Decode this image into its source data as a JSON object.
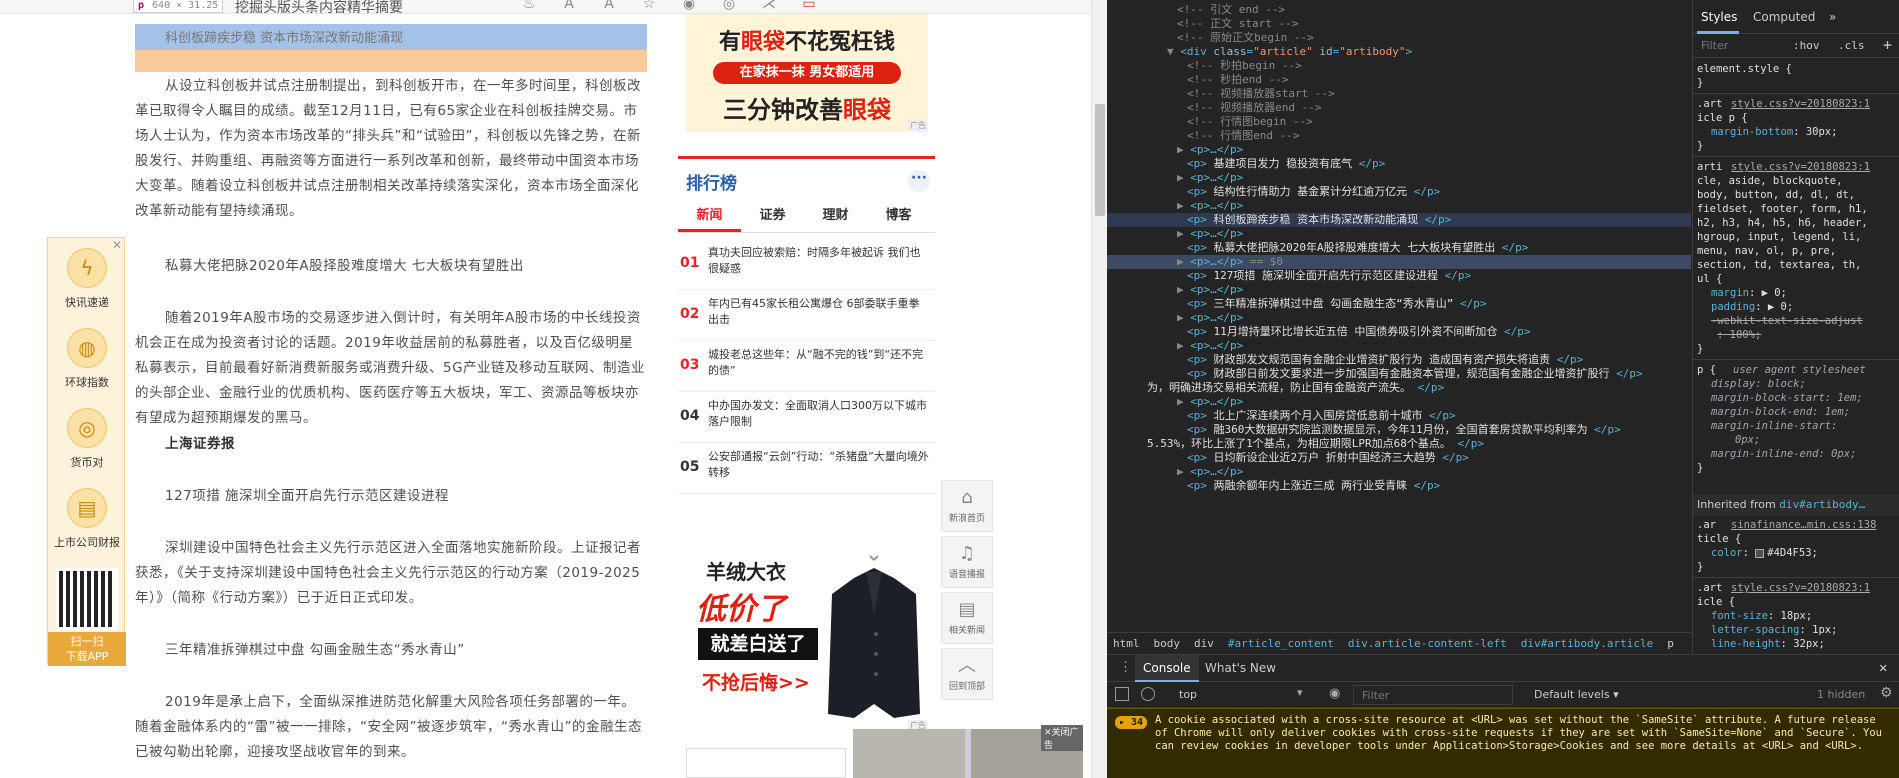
{
  "browser": {
    "tooltip_tag": "p",
    "tooltip_size": "640 × 31.25",
    "crumb": "挖掘头版头条内容精华摘要"
  },
  "highlight": {
    "text": "科创板蹄疾步稳 资本市场深改新动能涌现"
  },
  "article": {
    "p1": "从设立科创板并试点注册制提出，到科创板开市，在一年多时间里，科创板改革已取得令人瞩目的成绩。截至12月11日，已有65家企业在科创板挂牌交易。市场人士认为，作为资本市场改革的“排头兵”和“试验田”，科创板以先锋之势，在新股发行、并购重组、再融资等方面进行一系列改革和创新，最终带动中国资本市场大变革。随着设立科创板并试点注册制相关改革持续落实深化，资本市场全面深化改革新动能有望持续涌现。",
    "p2": "私募大佬把脉2020年A股择股难度增大 七大板块有望胜出",
    "p3": "随着2019年A股市场的交易逐步进入倒计时，有关明年A股市场的中长线投资机会正在成为投资者讨论的话题。2019年收益居前的私募胜者，以及百亿级明星私募表示，目前最看好新消费新服务或消费升级、5G产业链及移动互联网、制造业的头部企业、金融行业的优质机构、医药医疗等五大板块，军工、资源品等板块亦有望成为超预期爆发的黑马。",
    "p4": "上海证券报",
    "p5": "127项措 施深圳全面开启先行示范区建设进程",
    "p6": "深圳建设中国特色社会主义先行示范区进入全面落地实施新阶段。上证报记者获悉，《关于支持深圳建设中国特色社会主义先行示范区的行动方案（2019-2025年）》（简称《行动方案》）已于近日正式印发。",
    "p7": "三年精准拆弹棋过中盘 勾画金融生态“秀水青山”",
    "p8": "2019年是承上启下，全面纵深推进防范化解重大风险各项任务部署的一年。随着金融体系内的“雷”被一一排除，“安全网”被逐步筑牢，“秀水青山”的金融生态已被勾勒出轮廓，迎接攻坚战收官年的到来。"
  },
  "ad_top": {
    "line1a": "有",
    "line1b": "眼袋",
    "line1c": "不花冤枉钱",
    "pill": "在家抹一抹 男女都适用",
    "line3a": "三分钟改善",
    "line3b": "眼袋",
    "tag": "广告"
  },
  "ranking": {
    "title": "排行榜",
    "more": "···",
    "tabs": [
      "新闻",
      "证券",
      "理财",
      "博客"
    ],
    "items": [
      {
        "n": "01",
        "t": "真功夫回应被索赔：时隔多年被起诉 我们也很疑惑"
      },
      {
        "n": "02",
        "t": "年内已有45家长租公寓爆仓 6部委联手重拳出击"
      },
      {
        "n": "03",
        "t": "城投老总这些年：从“融不完的钱”到“还不完的债”"
      },
      {
        "n": "04",
        "t": "中办国办发文：全面取消人口300万以下城市落户限制"
      },
      {
        "n": "05",
        "t": "公安部通报“云剑”行动：“杀猪盘”大量向境外转移"
      }
    ]
  },
  "ad_bottom": {
    "a": "羊绒大衣",
    "b": "低价了",
    "c": "就差白送了",
    "d": "不抢后悔>>",
    "tag": "广告"
  },
  "float_nav": [
    {
      "icon": "⌂",
      "label": "新浪首页"
    },
    {
      "icon": "♫",
      "label": "语音播报"
    },
    {
      "icon": "▤",
      "label": "相关新闻"
    },
    {
      "icon": "︿",
      "label": "回到顶部"
    }
  ],
  "left_bar": {
    "close": "✕",
    "items": [
      {
        "icon": "ϟ",
        "label": "快讯速递"
      },
      {
        "icon": "◍",
        "label": "环球指数"
      },
      {
        "icon": "◎",
        "label": "货币对"
      },
      {
        "icon": "▤",
        "label": "上市公司财报"
      }
    ],
    "qr_label": "扫一扫\n下载APP"
  },
  "photos_tag": "✕关闭广告",
  "devtools": {
    "elements": [
      {
        "indent": 5,
        "type": "comment",
        "text": "<!-- 引文 end -->"
      },
      {
        "indent": 5,
        "type": "comment",
        "text": "<!-- 正文 start -->"
      },
      {
        "indent": 5,
        "type": "comment",
        "text": "<!-- 原始正文begin -->"
      },
      {
        "indent": 4,
        "type": "open",
        "arrow": "▼",
        "tag": "div",
        "attrs": [
          [
            "class",
            "article"
          ],
          [
            "id",
            "artibody"
          ]
        ]
      },
      {
        "indent": 6,
        "type": "comment",
        "text": "<!-- 秒拍begin -->"
      },
      {
        "indent": 6,
        "type": "comment",
        "text": "<!-- 秒拍end -->"
      },
      {
        "indent": 6,
        "type": "comment",
        "text": "<!-- 视频播放器start -->"
      },
      {
        "indent": 6,
        "type": "comment",
        "text": "<!-- 视频播放器end -->"
      },
      {
        "indent": 6,
        "type": "comment",
        "text": "<!-- 行情图begin -->"
      },
      {
        "indent": 6,
        "type": "comment",
        "text": "<!-- 行情图end -->"
      },
      {
        "indent": 5,
        "type": "collapsed",
        "arrow": "▶",
        "text": "<p>…</p>"
      },
      {
        "indent": 6,
        "type": "ptext",
        "text": "基建项目发力 稳投资有底气"
      },
      {
        "indent": 5,
        "type": "collapsed",
        "arrow": "▶",
        "text": "<p>…</p>"
      },
      {
        "indent": 6,
        "type": "ptext",
        "text": "结构性行情助力 基金累计分红逾万亿元"
      },
      {
        "indent": 5,
        "type": "collapsed",
        "arrow": "▶",
        "text": "<p>…</p>"
      },
      {
        "indent": 6,
        "type": "ptext",
        "text": "科创板蹄疾步稳 资本市场深改新动能涌现",
        "hover": true
      },
      {
        "indent": 5,
        "type": "collapsed",
        "arrow": "▶",
        "text": "<p>…</p>"
      },
      {
        "indent": 6,
        "type": "ptext",
        "text": "私募大佬把脉2020年A股择股难度增大 七大板块有望胜出"
      },
      {
        "indent": 5,
        "type": "collapsed",
        "arrow": "▶",
        "text": "<p>…</p>",
        "suffix": " == $0",
        "selected": true
      },
      {
        "indent": 6,
        "type": "ptext",
        "text": "127项措 施深圳全面开启先行示范区建设进程"
      },
      {
        "indent": 5,
        "type": "collapsed",
        "arrow": "▶",
        "text": "<p>…</p>"
      },
      {
        "indent": 6,
        "type": "ptext",
        "text": "三年精准拆弹棋过中盘 勾画金融生态“秀水青山”"
      },
      {
        "indent": 5,
        "type": "collapsed",
        "arrow": "▶",
        "text": "<p>…</p>"
      },
      {
        "indent": 6,
        "type": "ptext",
        "text": "11月增持量环比增长近五倍 中国债券吸引外资不间断加仓"
      },
      {
        "indent": 5,
        "type": "collapsed",
        "arrow": "▶",
        "text": "<p>…</p>"
      },
      {
        "indent": 6,
        "type": "ptext",
        "text": "财政部发文规范国有金融企业增资扩股行为 造成国有资产损失将追责"
      },
      {
        "indent": 6,
        "type": "ptext",
        "text": "财政部日前发文要求进一步加强国有金融资本管理，规范国有金融企业增资扩股行"
      },
      {
        "indent": 6,
        "type": "ptextcont",
        "text": "为，明确进场交易相关流程，防止国有金融资产流失。"
      },
      {
        "indent": 5,
        "type": "collapsed",
        "arrow": "▶",
        "text": "<p>…</p>"
      },
      {
        "indent": 6,
        "type": "ptext",
        "text": "北上广深连续两个月入围房贷低息前十城市"
      },
      {
        "indent": 6,
        "type": "ptext",
        "text": "融360大数据研究院监测数据显示，今年11月份，全国首套房贷款平均利率为"
      },
      {
        "indent": 6,
        "type": "ptextcont",
        "text": "5.53%，环比上涨了1个基点，为相应期限LPR加点68个基点。"
      },
      {
        "indent": 6,
        "type": "ptext",
        "text": "日均新设企业近2万户 折射中国经济三大趋势"
      },
      {
        "indent": 5,
        "type": "collapsed",
        "arrow": "▶",
        "text": "<p>…</p>"
      },
      {
        "indent": 6,
        "type": "ptext",
        "text": "两融余额年内上涨近三成 两行业受青睐"
      }
    ],
    "breadcrumbs": [
      "html",
      "body",
      "div",
      "#article_content",
      "div.article-content-left",
      "div#artibody.article",
      "p"
    ],
    "styles": {
      "tabs": [
        "Styles",
        "Computed",
        "»"
      ],
      "filter_placeholder": "Filter",
      "hov": ":hov",
      "cls": ".cls",
      "plus": "+",
      "rules": [
        {
          "type": "sel",
          "text": "element.style {"
        },
        {
          "type": "close",
          "text": "}"
        },
        {
          "type": "gap"
        },
        {
          "type": "selsrc",
          "text": ".art",
          "src": "style.css?v=20180823:1"
        },
        {
          "type": "sel",
          "text": "icle p {"
        },
        {
          "type": "prop",
          "name": "margin-bottom",
          "value": "30px;"
        },
        {
          "type": "close",
          "text": "}"
        },
        {
          "type": "gap"
        },
        {
          "type": "selsrc",
          "text": "arti",
          "src": "style.css?v=20180823:1"
        },
        {
          "type": "sel",
          "text": "cle, aside, blockquote,"
        },
        {
          "type": "sel",
          "text": "body, button, dd, dl, dt,"
        },
        {
          "type": "sel",
          "text": "fieldset, footer, form, h1,"
        },
        {
          "type": "sel",
          "text": "h2, h3, h4, h5, h6, header,"
        },
        {
          "type": "sel",
          "text": "hgroup, input, legend, li,"
        },
        {
          "type": "sel",
          "text": "menu, nav, ol, p, pre,"
        },
        {
          "type": "sel",
          "text": "section, td, textarea, th,"
        },
        {
          "type": "sel",
          "text": "ul {"
        },
        {
          "type": "prop",
          "name": "margin",
          "value": "▶ 0;"
        },
        {
          "type": "prop",
          "name": "padding",
          "value": "▶ 0;"
        },
        {
          "type": "strike",
          "text": "-webkit-text-size-adjust"
        },
        {
          "type": "strike2",
          "text": ": 100%;"
        },
        {
          "type": "close",
          "text": "}"
        },
        {
          "type": "gap"
        },
        {
          "type": "uasrc",
          "text": "p {",
          "src": "user agent stylesheet"
        },
        {
          "type": "ua",
          "text": "display: block;"
        },
        {
          "type": "ua",
          "text": "margin-block-start: 1em;"
        },
        {
          "type": "ua",
          "text": "margin-block-end: 1em;"
        },
        {
          "type": "ua",
          "text": "margin-inline-start:"
        },
        {
          "type": "ua2",
          "text": "0px;"
        },
        {
          "type": "ua",
          "text": "margin-inline-end: 0px;"
        },
        {
          "type": "close",
          "text": "}"
        }
      ],
      "inherited_label": "Inherited from",
      "inherited_from": "div#artibody…",
      "rules2": [
        {
          "type": "selsrc",
          "text": ".ar",
          "src": "sinafinance…min.css:138"
        },
        {
          "type": "sel",
          "text": "ticle {"
        },
        {
          "type": "propc",
          "name": "color",
          "value": "#4D4F53;"
        },
        {
          "type": "close",
          "text": "}"
        },
        {
          "type": "gap"
        },
        {
          "type": "selsrc",
          "text": ".art",
          "src": "style.css?v=20180823:1"
        },
        {
          "type": "sel",
          "text": "icle {"
        },
        {
          "type": "prop",
          "name": "font-size",
          "value": "18px;"
        },
        {
          "type": "prop",
          "name": "letter-spacing",
          "value": "1px;"
        },
        {
          "type": "prop",
          "name": "line-height",
          "value": "32px;"
        }
      ]
    },
    "console": {
      "tabs": [
        "Console",
        "What's New"
      ],
      "context": "top",
      "filter_placeholder": "Filter",
      "levels": "Default levels ▾",
      "hidden": "1 hidden",
      "warn_count": "▸ 34",
      "warn_text": "A cookie associated with a cross-site resource at <URL> was set without the `SameSite` attribute. A future release of Chrome will only deliver cookies with cross-site requests if they are set with `SameSite=None` and `Secure`. You can review cookies in developer tools under Application>Storage>Cookies and see more details at <URL> and <URL>."
    }
  }
}
